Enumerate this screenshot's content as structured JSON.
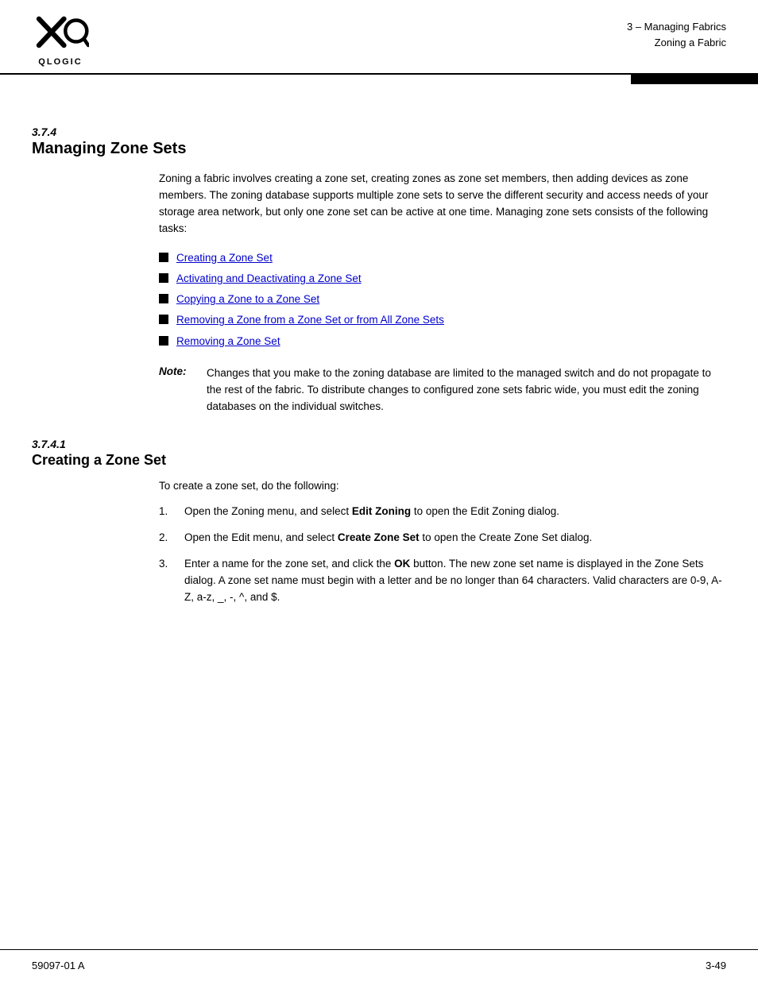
{
  "header": {
    "chapter": "3 – Managing Fabrics",
    "section": "Zoning a Fabric"
  },
  "section374": {
    "number": "3.7.4",
    "title": "Managing Zone Sets",
    "intro": "Zoning a fabric involves creating a zone set, creating zones as zone set members, then adding devices as zone members. The zoning database supports multiple zone sets to serve the different security and access needs of your storage area network, but only one zone set can be active at one time. Managing zone sets consists of the following tasks:"
  },
  "bullets": [
    {
      "text": "Creating a Zone Set"
    },
    {
      "text": "Activating and Deactivating a Zone Set"
    },
    {
      "text": "Copying a Zone to a Zone Set"
    },
    {
      "text": "Removing a Zone from a Zone Set or from All Zone Sets"
    },
    {
      "text": "Removing a Zone Set"
    }
  ],
  "note": {
    "label": "Note:",
    "text": "Changes that you make to the zoning database are limited to the managed switch and do not propagate to the rest of the fabric. To distribute changes to configured zone sets fabric wide, you must edit the zoning databases on the individual switches."
  },
  "section3741": {
    "number": "3.7.4.1",
    "title": "Creating a Zone Set",
    "intro": "To create a zone set, do the following:"
  },
  "steps": [
    {
      "num": "1.",
      "text_plain": "Open the Zoning menu, and select ",
      "text_bold": "Edit Zoning",
      "text_after": " to open the Edit Zoning dialog."
    },
    {
      "num": "2.",
      "text_plain": "Open the Edit menu, and select ",
      "text_bold": "Create Zone Set",
      "text_after": " to open the Create Zone Set dialog."
    },
    {
      "num": "3.",
      "text_plain": "Enter a name for the zone set, and click the ",
      "text_bold": "OK",
      "text_after": " button. The new zone set name is displayed in the Zone Sets dialog. A zone set name must begin with a letter and be no longer than 64 characters. Valid characters are 0-9, A-Z, a-z, _, -, ^, and $."
    }
  ],
  "footer": {
    "left": "59097-01 A",
    "right": "3-49"
  }
}
